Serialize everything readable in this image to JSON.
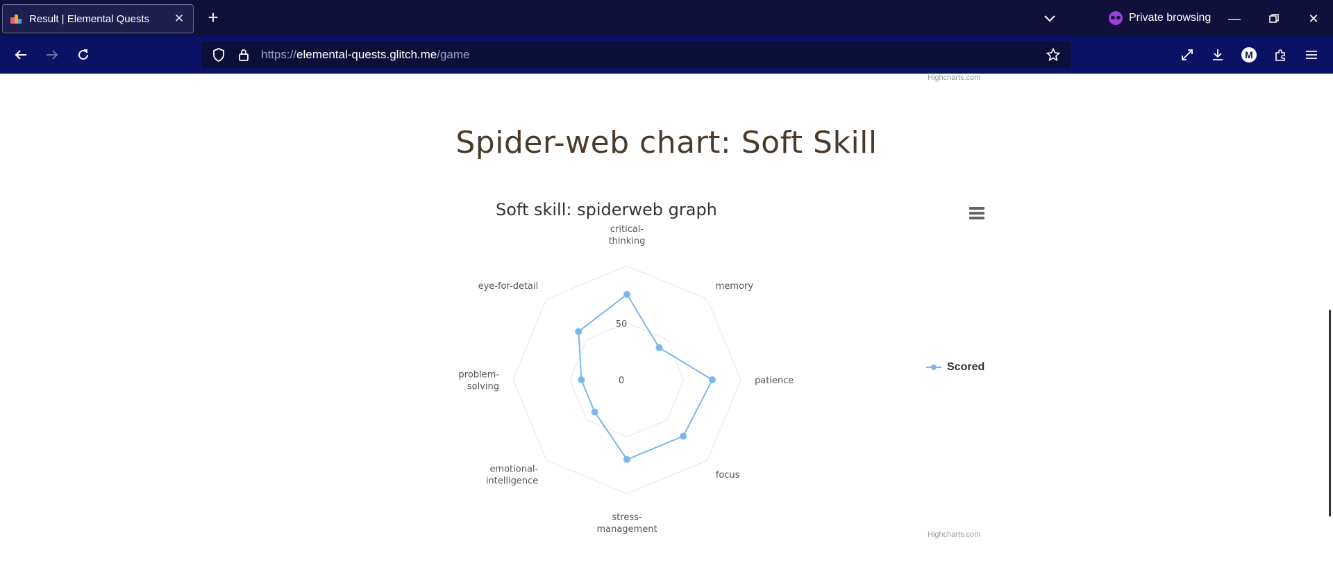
{
  "browser": {
    "tab_title": "Result | Elemental Quests",
    "private_label": "Private browsing",
    "url_scheme": "https://",
    "url_host": "elemental-quests.glitch.me",
    "url_path": "/game",
    "profile_initial": "M"
  },
  "page": {
    "credit_top": "Highcharts.com",
    "section_title": "Spider-web chart: Soft Skill",
    "credit_bottom": "Highcharts.com"
  },
  "chart_data": {
    "type": "radar",
    "title": "Soft skill: spiderweb graph",
    "categories": [
      "critical-thinking",
      "memory",
      "patience",
      "focus",
      "stress-management",
      "emotional-intelligence",
      "problem-solving",
      "eye-for-detail"
    ],
    "category_lines": [
      [
        "critical-",
        "thinking"
      ],
      [
        "memory"
      ],
      [
        "patience"
      ],
      [
        "focus"
      ],
      [
        "stress-",
        "management"
      ],
      [
        "emotional-",
        "intelligence"
      ],
      [
        "problem-",
        "solving"
      ],
      [
        "eye-for-detail"
      ]
    ],
    "series": [
      {
        "name": "Scored",
        "values": [
          75,
          40,
          75,
          70,
          70,
          40,
          40,
          60
        ],
        "color": "#7cb5ec"
      }
    ],
    "radial_ticks": [
      "0",
      "50"
    ],
    "ylim": [
      0,
      100
    ],
    "grid": true,
    "legend_position": "right"
  }
}
